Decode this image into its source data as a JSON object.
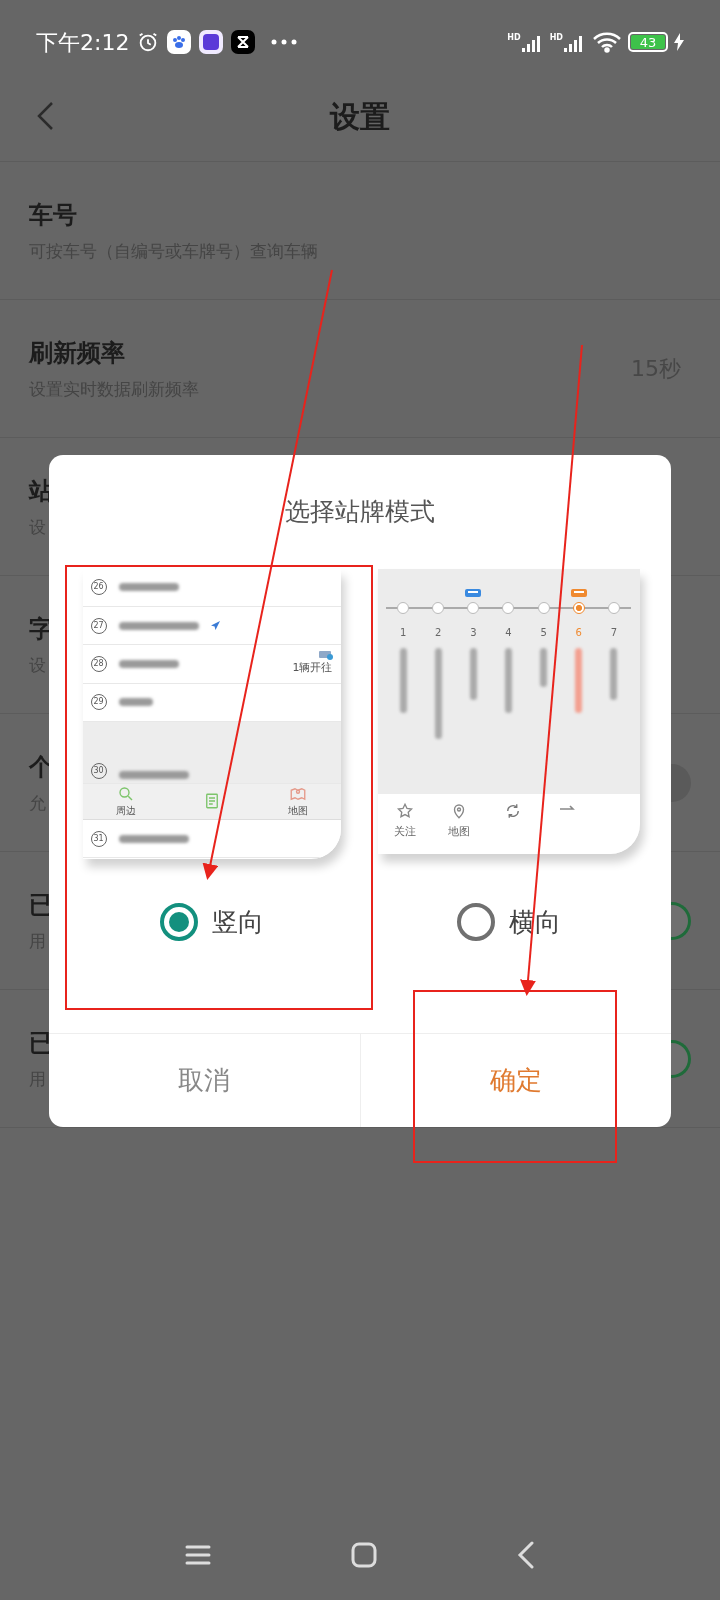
{
  "status_bar": {
    "time": "下午2:12",
    "signal_labels": [
      "HD",
      "HD"
    ],
    "battery": "43"
  },
  "header": {
    "title": "设置"
  },
  "settings": [
    {
      "title": "车号",
      "subtitle": "可按车号（自编号或车牌号）查询车辆",
      "kind": "plain"
    },
    {
      "title": "刷新频率",
      "subtitle": "设置实时数据刷新频率",
      "value": "15秒",
      "kind": "value"
    },
    {
      "title": "站",
      "subtitle": "设",
      "kind": "plain"
    },
    {
      "title": "字",
      "subtitle": "设",
      "kind": "plain"
    },
    {
      "title": "个",
      "subtitle": "允",
      "kind": "toggle",
      "on": false
    },
    {
      "title": "已",
      "subtitle": "用",
      "kind": "toggle",
      "on": true
    },
    {
      "title": "已",
      "subtitle": "用",
      "kind": "toggle",
      "on": true
    }
  ],
  "dialog": {
    "title": "选择站牌模式",
    "options": [
      {
        "label": "竖向",
        "selected": true,
        "preview": {
          "kind": "vertical",
          "stations": [
            {
              "number": "26",
              "located": false,
              "highlighted": false
            },
            {
              "number": "27",
              "located": true,
              "highlighted": false
            },
            {
              "number": "28",
              "bus_note": "1辆开往",
              "located": false,
              "highlighted": false
            },
            {
              "number": "29",
              "located": false,
              "highlighted": false
            },
            {
              "number": "30",
              "located": false,
              "highlighted": true
            },
            {
              "number": "31",
              "located": false,
              "highlighted": false
            }
          ],
          "toolbar": [
            {
              "label": "周边",
              "kind": "search"
            },
            {
              "kind": "list"
            },
            {
              "label": "地图",
              "kind": "map"
            }
          ]
        }
      },
      {
        "label": "横向",
        "selected": false,
        "preview": {
          "kind": "horizontal",
          "stations": [
            {
              "number": "1",
              "current": false,
              "bus": false
            },
            {
              "number": "2",
              "current": false,
              "bus": false
            },
            {
              "number": "3",
              "current": false,
              "bus": true
            },
            {
              "number": "4",
              "current": false,
              "bus": false
            },
            {
              "number": "5",
              "current": false,
              "bus": false
            },
            {
              "number": "6",
              "current": true,
              "bus": true
            },
            {
              "number": "7",
              "current": false,
              "bus": false
            }
          ],
          "toolbar": [
            {
              "label": "关注",
              "kind": "star"
            },
            {
              "label": "地图",
              "kind": "pin"
            },
            {
              "kind": "refresh"
            },
            {
              "kind": "swap"
            }
          ]
        }
      }
    ],
    "buttons": [
      {
        "label": "取消",
        "kind": "cancel"
      },
      {
        "label": "确定",
        "kind": "confirm"
      }
    ]
  }
}
